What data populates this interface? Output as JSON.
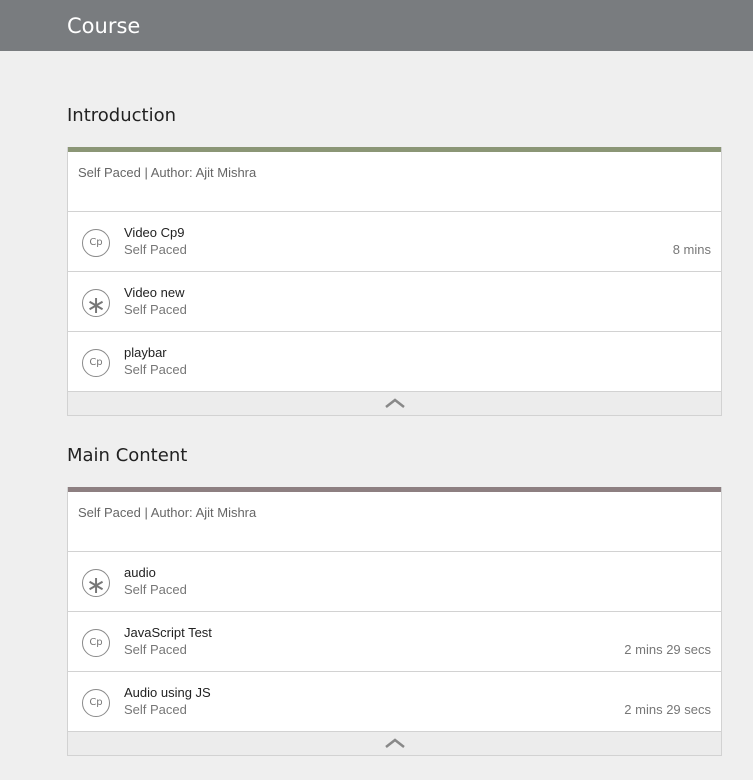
{
  "header": {
    "title": "Course"
  },
  "colors": {
    "header_bg": "#797c7f",
    "intro_bar": "#8b9676",
    "main_bar": "#8d7f81"
  },
  "sections": [
    {
      "title": "Introduction",
      "meta": "Self Paced | Author: Ajit Mishra",
      "items": [
        {
          "icon": "captivate-icon",
          "name": "Video Cp9",
          "status": "Self Paced",
          "duration": "8 mins"
        },
        {
          "icon": "asterisk-icon",
          "name": "Video new",
          "status": "Self Paced",
          "duration": ""
        },
        {
          "icon": "captivate-icon",
          "name": "playbar",
          "status": "Self Paced",
          "duration": ""
        }
      ]
    },
    {
      "title": "Main Content",
      "meta": "Self Paced | Author: Ajit Mishra",
      "items": [
        {
          "icon": "asterisk-icon",
          "name": "audio",
          "status": "Self Paced",
          "duration": ""
        },
        {
          "icon": "captivate-icon",
          "name": "JavaScript Test",
          "status": "Self Paced",
          "duration": "2 mins 29 secs"
        },
        {
          "icon": "captivate-icon",
          "name": "Audio using JS",
          "status": "Self Paced",
          "duration": "2 mins 29 secs"
        }
      ]
    }
  ]
}
